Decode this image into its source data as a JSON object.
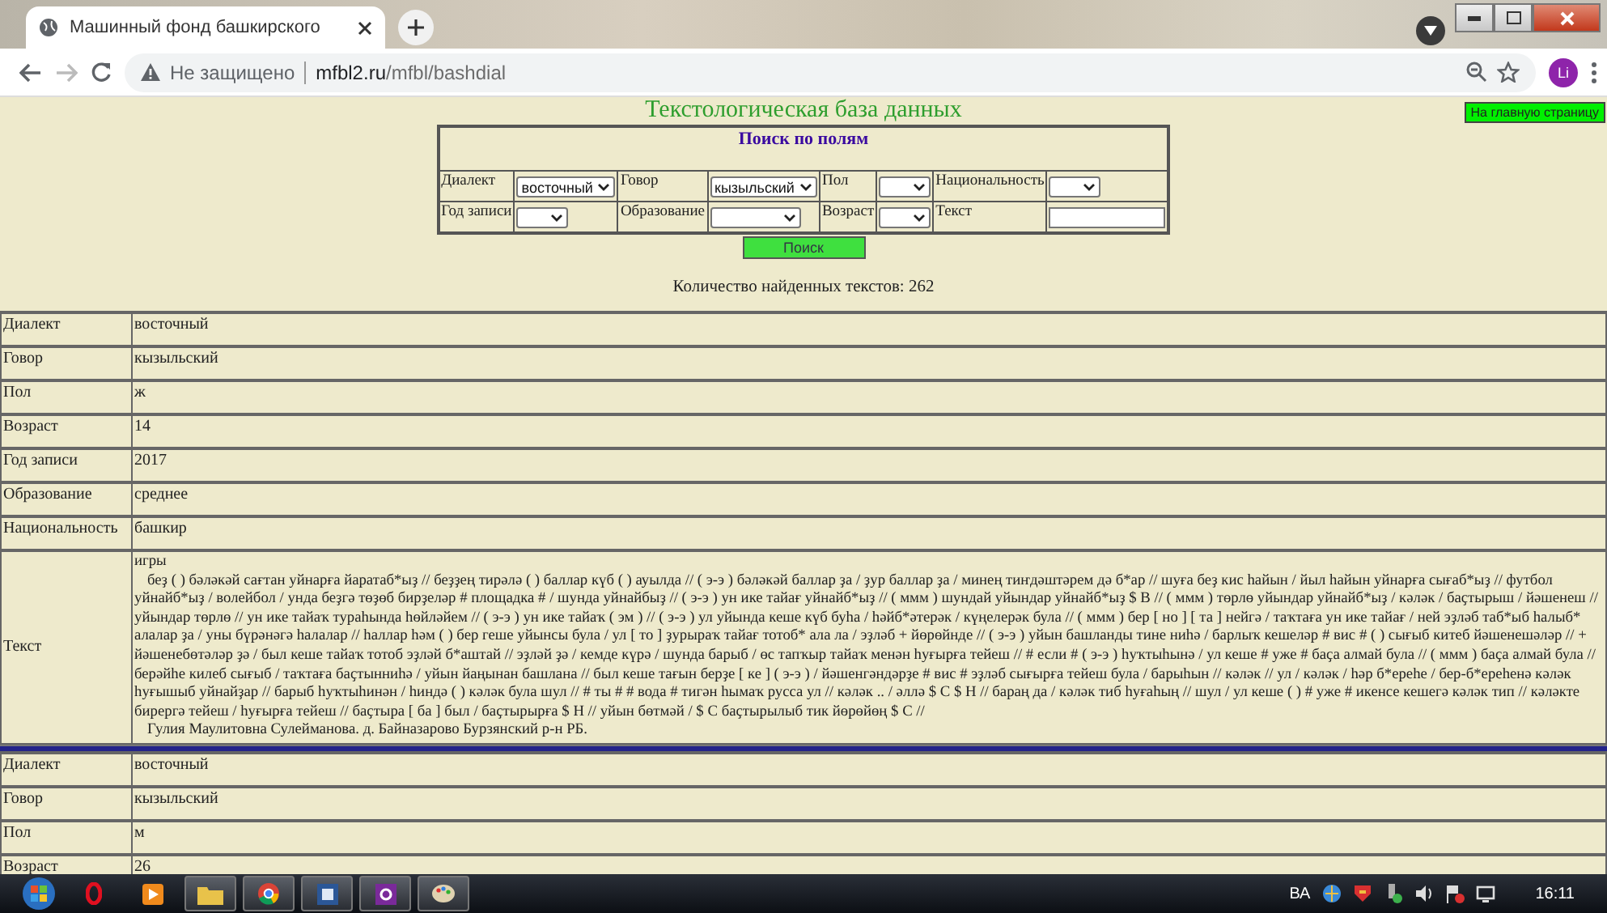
{
  "browser": {
    "tab_title": "Машинный фонд башкирского",
    "security_label": "Не защищено",
    "url_host": "mfbl2.ru",
    "url_path": "/mfbl/bashdial",
    "avatar": "Li"
  },
  "page": {
    "title": "Текстологическая база данных",
    "home_button": "На главную страницу",
    "search": {
      "heading": "Поиск по полям",
      "rows": [
        [
          {
            "label": "Диалект",
            "kind": "select",
            "value": "восточный"
          },
          {
            "label": "Говор",
            "kind": "select",
            "value": "кызыльский"
          },
          {
            "label": "Пол",
            "kind": "select"
          },
          {
            "label": "Национальность",
            "kind": "select"
          }
        ],
        [
          {
            "label": "Год записи",
            "kind": "select"
          },
          {
            "label": "Образование",
            "kind": "select"
          },
          {
            "label": "Возраст",
            "kind": "select"
          },
          {
            "label": "Текст",
            "kind": "text"
          }
        ]
      ],
      "button": "Поиск"
    },
    "count_text": "Количество найденных текстов: 262",
    "records": [
      {
        "fields": [
          {
            "label": "Диалект",
            "kind": "plain",
            "value": "восточный"
          },
          {
            "label": "Говор",
            "kind": "plain",
            "value": "кызыльский"
          },
          {
            "label": "Пол",
            "kind": "plain",
            "value": "ж"
          },
          {
            "label": "Возраст",
            "kind": "plain",
            "value": "14"
          },
          {
            "label": "Год записи",
            "kind": "plain",
            "value": "2017"
          },
          {
            "label": "Образование",
            "kind": "plain",
            "value": "среднее"
          },
          {
            "label": "Национальность",
            "kind": "plain",
            "value": "башкир"
          },
          {
            "label": "Текст",
            "kind": "transcript",
            "topic": "игры",
            "body": "беҙ ( ) бәләкәй сағтан уйнарға йаратаб*ыҙ // беҙҙең тирәлә ( ) баллар күб ( ) ауылда // ( э-э ) бәләкәй баллар ҙа / ҙур баллар ҙа / минең тиҥдәштәрем дә б*ар // шуға беҙ кис һайын / йыл һайын уйнарға сығаб*ыҙ // футбол уйнайб*ыҙ / волейбол / унда беҙгә төҙөб бирҙеләр # площадка # / шунда уйнайбыҙ // ( э-э ) ун ике тайағ уйнайб*ыҙ // ( ммм ) шундай уйындар уйнайб*ыҙ $ В // ( ммм ) төрлө уйындар уйнайб*ыҙ / кәләк / баҫтырыш / йәшенеш // уйындар төрлө // ун ике тайаҡ тураһында һөйләйем // ( э-э ) ун ике тайаҡ ( эм ) // ( э-э ) ул уйында кеше күб буһа / һәйб*әтерәк / күңелерәк була // ( ммм ) бер [ но ] [ та ] нейгә / таҡтаға ун ике тайағ / ней эҙләб таб*ыб һалыб* алалар ҙа / уны бүрәнәгә һалалар // һаллар һәм ( ) бер геше уйынсы була / ул [ то ] ҙурыраҡ тайағ тотоб* ала ла / эҙләб + йөрөйнде // ( э-э ) уйын башланды тине ниһә / барлыҡ кешеләр # вис # ( ) сығыб китеб йәшенешәләр // + йәшенебөтәләр ҙә / был кеше тайаҡ тотоб эҙләй б*аштай // эҙләй ҙә / кемде күрә / шунда барыб / өс тапҡыр тайаҡ менән һуғырға тейеш // # если # ( э-э ) һуҡтыһынә / ул кеше # уже # баҫа алмай була // ( ммм ) баҫа алмай була // берәйһе килеб сығыб / таҡтаға баҫтынниһә / уйын йаңынан башлана // был кеше тағын берҙе [ ке ] ( э-э ) / йәшенгәндәрҙе # вис # эҙләб сығырға тейеш була / барыһын // кәләк // ул / кәләк / һәр б*ереһе / бер-б*ереһенә кәләк һуғышыб уйнайҙар // барыб һуҡтыһинән / һиндә ( ) кәләк була шул // # ты # # вода # тигән һымаҡ русса ул // кәләк .. / әллә $ С $ Н // бараң да / кәләк тиб һуғаһың // шул / ул кеше ( ) # уже # икенсе кешегә кәләк тип // кәләкте бирергә тейеш / һуғырға тейеш // баҫтыра [ ба ] был / баҫтырырға $ Н // уйын бөтмәй / $ С баҫтырылыб тик йөрөйөң $ С //",
            "speaker": "Гулия Маулитовна Сулейманова. д. Байназарово Бурзянский р-н РБ."
          }
        ]
      },
      {
        "fields": [
          {
            "label": "Диалект",
            "kind": "plain",
            "value": "восточный"
          },
          {
            "label": "Говор",
            "kind": "plain",
            "value": "кызыльский"
          },
          {
            "label": "Пол",
            "kind": "plain",
            "value": "м"
          },
          {
            "label": "Возраст",
            "kind": "plain",
            "value": "26"
          }
        ]
      }
    ]
  },
  "taskbar": {
    "language": "ВА",
    "time": "16:11"
  }
}
